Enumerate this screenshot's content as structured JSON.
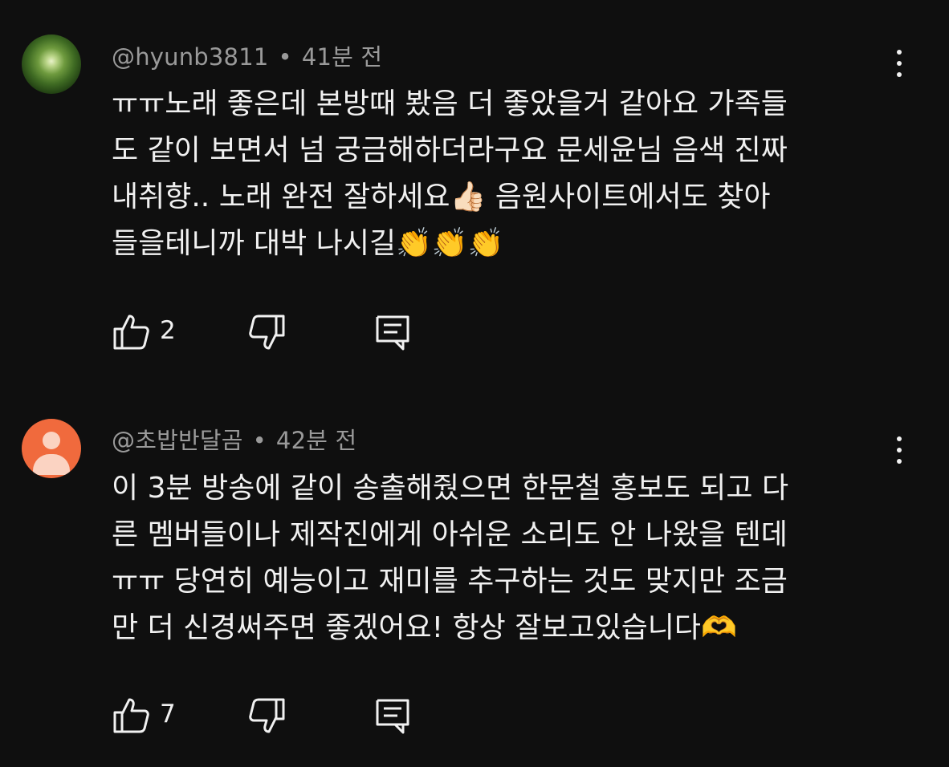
{
  "comments": [
    {
      "username": "@hyunb3811",
      "separator": "•",
      "time": "41분 전",
      "avatar": "forest-photo",
      "lines": [
        "ㅠㅠ노래 좋은데 본방때 봤음 더 좋았을거 같아요 가족들",
        "도 같이 보면서 넘 궁금해하더라구요 문세윤님 음색 진짜",
        "내취향.. 노래 완전 잘하세요👍🏻 음원사이트에서도 찾아",
        "들을테니까 대박 나시길👏👏👏"
      ],
      "likes": "2",
      "icons": {
        "like": "thumb-up-icon",
        "dislike": "thumb-down-icon",
        "reply": "reply-icon",
        "more": "kebab-menu-icon"
      }
    },
    {
      "username": "@초밥반달곰",
      "separator": "•",
      "time": "42분 전",
      "avatar": "default-person",
      "avatar_color": "#f06a3d",
      "lines": [
        "이 3분 방송에 같이 송출해줬으면 한문철 홍보도 되고 다",
        "른 멤버들이나 제작진에게 아쉬운 소리도 안 나왔을 텐데",
        "ㅠㅠ 당연히 예능이고 재미를 추구하는 것도 맞지만 조금",
        "만 더 신경써주면 좋겠어요! 항상 잘보고있습니다🫶"
      ],
      "likes": "7",
      "icons": {
        "like": "thumb-up-icon",
        "dislike": "thumb-down-icon",
        "reply": "reply-icon",
        "more": "kebab-menu-icon"
      }
    }
  ],
  "colors": {
    "background": "#0f0f0f",
    "text": "#f1f1f1",
    "meta": "#9a9a9a"
  }
}
